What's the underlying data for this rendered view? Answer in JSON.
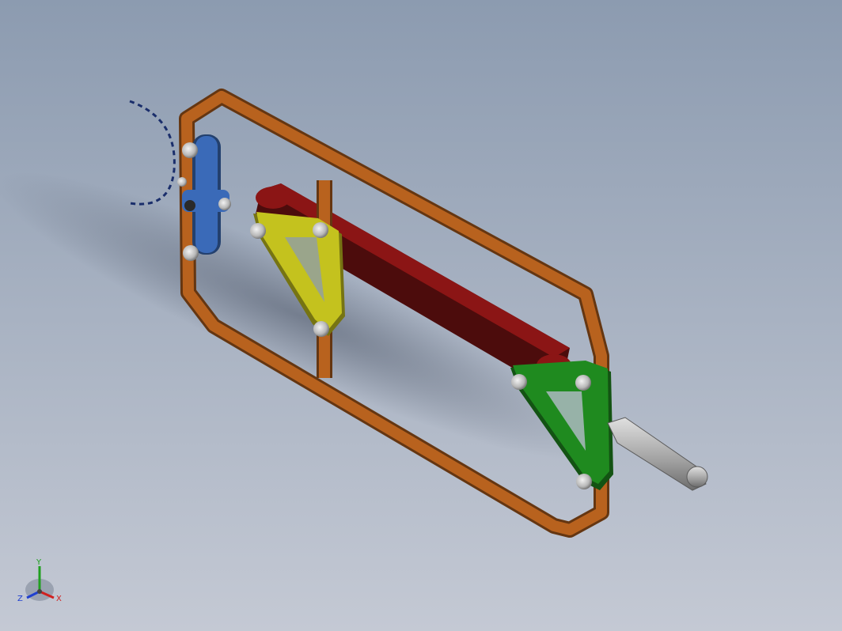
{
  "viewport": {
    "background_top": "#8c9bb0",
    "background_bottom": "#c4c9d4"
  },
  "parts": {
    "frame": {
      "name": "frame",
      "color": "#b8621e"
    },
    "crank": {
      "name": "crank",
      "color": "#3a6ab8"
    },
    "coupler": {
      "name": "coupler",
      "color": "#8b1515"
    },
    "rocker_yellow": {
      "name": "rocker-yellow",
      "color": "#c4c21e"
    },
    "rocker_green": {
      "name": "rocker-green",
      "color": "#1f8a1f"
    },
    "handle": {
      "name": "handle",
      "color": "#a8a8a8"
    },
    "path_arc": {
      "name": "crank-path-arc",
      "color": "#1a2e6b"
    }
  },
  "triad": {
    "x_label": "X",
    "y_label": "Y",
    "z_label": "Z",
    "x_color": "#d02020",
    "y_color": "#20a020",
    "z_color": "#2040d0"
  }
}
